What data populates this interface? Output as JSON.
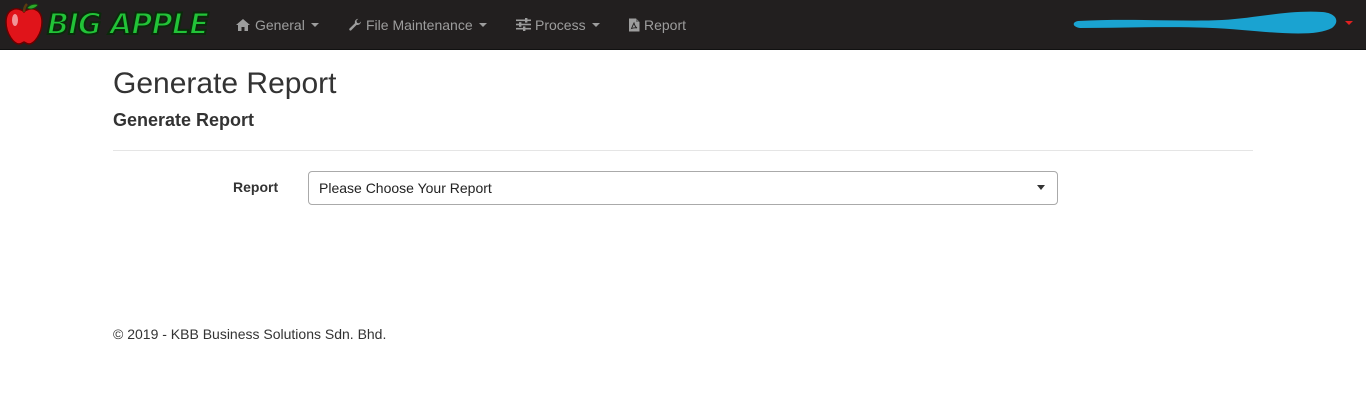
{
  "brand": {
    "name": "BIG APPLE",
    "icon": "apple-icon",
    "colors": {
      "text": "#22c338",
      "apple": "#e0141a"
    }
  },
  "nav": {
    "items": [
      {
        "label": "General",
        "icon": "home-icon",
        "has_dropdown": true
      },
      {
        "label": "File Maintenance",
        "icon": "wrench-icon",
        "has_dropdown": true
      },
      {
        "label": "Process",
        "icon": "sliders-icon",
        "has_dropdown": true
      },
      {
        "label": "Report",
        "icon": "file-pdf-icon",
        "has_dropdown": false
      }
    ],
    "colors": {
      "background": "#221f1f",
      "text": "#9d9d9d"
    }
  },
  "user_menu": {
    "redacted": true,
    "redaction_color": "#1aa3d1"
  },
  "page": {
    "title": "Generate Report",
    "subtitle": "Generate Report"
  },
  "form": {
    "report_label": "Report",
    "report_select_value": "Please Choose Your Report"
  },
  "footer": {
    "text": "© 2019 - KBB Business Solutions Sdn. Bhd."
  }
}
